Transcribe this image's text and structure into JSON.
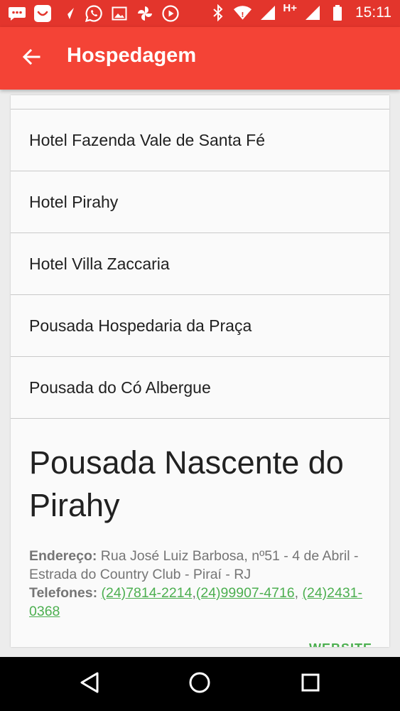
{
  "status_bar": {
    "time": "15:11",
    "network": "H+",
    "notification_icons": [
      "chat-bubble-icon",
      "smiley-icon",
      "send-icon",
      "whatsapp-icon",
      "image-icon",
      "pinwheel-icon",
      "play-icon"
    ],
    "status_icons": [
      "bluetooth-icon",
      "wifi-icon",
      "signal-icon",
      "battery-icon"
    ]
  },
  "app_bar": {
    "title": "Hospedagem",
    "back_icon": "arrow-back-icon"
  },
  "list": {
    "items": [
      {
        "label": "Hotel Fazenda Vale de Santa Fé"
      },
      {
        "label": "Hotel Pirahy"
      },
      {
        "label": "Hotel Villa Zaccaria"
      },
      {
        "label": "Pousada Hospedaria da Praça"
      },
      {
        "label": "Pousada do Có Albergue"
      }
    ]
  },
  "detail": {
    "title": "Pousada Nascente do Pirahy",
    "address_label": "Endereço:",
    "address": "Rua José Luiz Barbosa, nº51 - 4 de Abril - Estrada do Country Club - Piraí - RJ",
    "phones_label": "Telefones:",
    "phones": [
      "(24)7814-2214",
      "(24)99907-4716",
      "(24)2431-0368"
    ],
    "phone_separator": ",",
    "website_label": "WEBSITE"
  },
  "colors": {
    "status_bar": "#e3352c",
    "app_bar": "#f44336",
    "link": "#4caf50"
  },
  "nav_bar": {
    "icons": [
      "nav-back-icon",
      "nav-home-icon",
      "nav-recents-icon"
    ]
  }
}
